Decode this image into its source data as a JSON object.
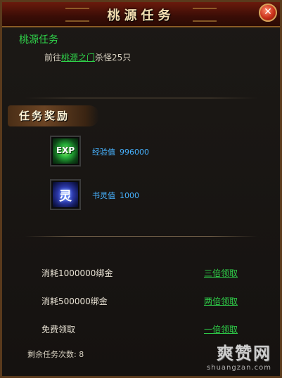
{
  "window": {
    "title": "桃源任务",
    "close_glyph": "✕"
  },
  "quest": {
    "name": "桃源任务",
    "desc_prefix": "前往",
    "desc_link": "桃源之门",
    "desc_suffix": "杀怪25只"
  },
  "rewards": {
    "banner": "任务奖励",
    "items": [
      {
        "icon": "exp-icon",
        "icon_text": "EXP",
        "label": "经验值",
        "value": "996000"
      },
      {
        "icon": "ling-icon",
        "icon_text": "灵",
        "label": "书灵值",
        "value": "1000"
      }
    ]
  },
  "claims": [
    {
      "cost": "消耗1000000绑金",
      "action": "三倍领取"
    },
    {
      "cost": "消耗500000绑金",
      "action": "两倍领取"
    },
    {
      "cost": "免费领取",
      "action": "一倍领取"
    }
  ],
  "remaining": {
    "label": "剩余任务次数:",
    "value": "8"
  },
  "watermark": {
    "top": "爽赞网",
    "bottom": "shuangzan.com"
  },
  "colors": {
    "accent_green": "#2fd24a",
    "reward_blue": "#47b2ff",
    "title_gold": "#f2ddb0",
    "frame_brown": "#5a3a1c"
  }
}
